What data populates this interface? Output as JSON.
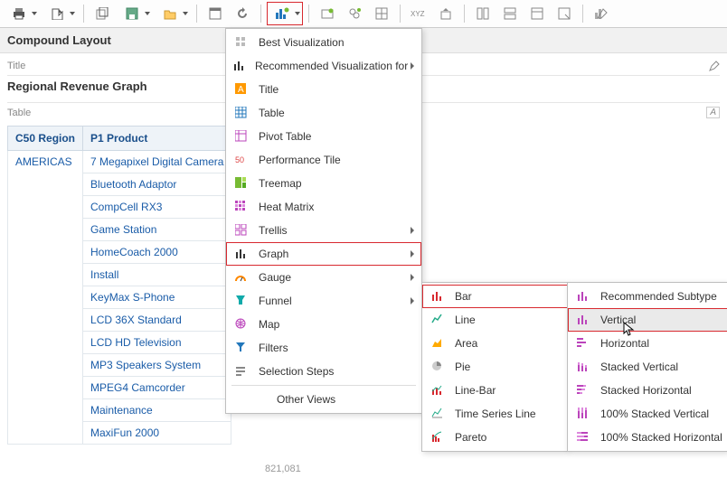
{
  "section_title": "Compound Layout",
  "title_block": {
    "label": "Title",
    "value": "Regional Revenue Graph"
  },
  "table_block": {
    "label": "Table",
    "columns": [
      "C50 Region",
      "P1 Product"
    ],
    "region": "AMERICAS",
    "products": [
      "7 Megapixel Digital Camera",
      "Bluetooth Adaptor",
      "CompCell RX3",
      "Game Station",
      "HomeCoach 2000",
      "Install",
      "KeyMax S-Phone",
      "LCD 36X Standard",
      "LCD HD Television",
      "MP3 Speakers System",
      "MPEG4 Camcorder",
      "Maintenance",
      "MaxiFun 2000"
    ]
  },
  "views_menu": {
    "items": [
      {
        "label": "Best Visualization"
      },
      {
        "label": "Recommended Visualization for",
        "sub": true
      },
      {
        "label": "Title"
      },
      {
        "label": "Table"
      },
      {
        "label": "Pivot Table"
      },
      {
        "label": "Performance Tile"
      },
      {
        "label": "Treemap"
      },
      {
        "label": "Heat Matrix"
      },
      {
        "label": "Trellis",
        "sub": true
      },
      {
        "label": "Graph",
        "sub": true,
        "hl": true
      },
      {
        "label": "Gauge",
        "sub": true
      },
      {
        "label": "Funnel",
        "sub": true
      },
      {
        "label": "Map"
      },
      {
        "label": "Filters"
      },
      {
        "label": "Selection Steps"
      },
      {
        "label": "Other Views",
        "sub": true
      }
    ]
  },
  "graph_menu": {
    "items": [
      {
        "label": "Bar",
        "sub": true,
        "hl": true
      },
      {
        "label": "Line",
        "sub": true
      },
      {
        "label": "Area",
        "sub": true
      },
      {
        "label": "Pie"
      },
      {
        "label": "Line-Bar",
        "sub": true
      },
      {
        "label": "Time Series Line"
      },
      {
        "label": "Pareto"
      }
    ]
  },
  "bar_menu": {
    "items": [
      {
        "label": "Recommended Subtype"
      },
      {
        "label": "Vertical",
        "hl": true,
        "hover": true
      },
      {
        "label": "Horizontal"
      },
      {
        "label": "Stacked Vertical"
      },
      {
        "label": "Stacked Horizontal"
      },
      {
        "label": "100% Stacked Vertical"
      },
      {
        "label": "100% Stacked Horizontal"
      }
    ]
  },
  "footer_number": "821,081"
}
